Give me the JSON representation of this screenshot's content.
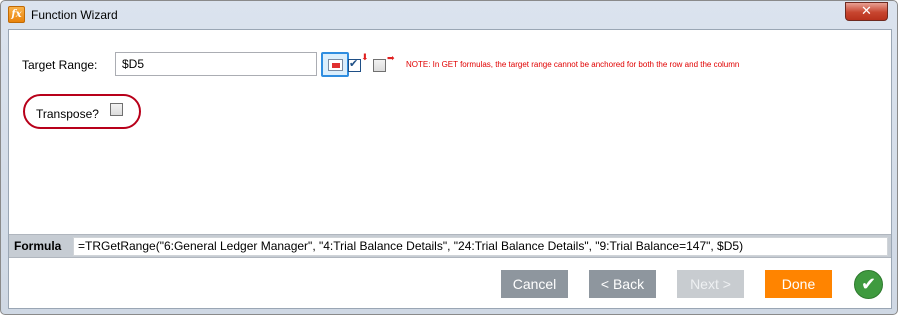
{
  "window": {
    "title": "Function Wizard",
    "icon_text": "fx",
    "close_symbol": "✕"
  },
  "target_range": {
    "label": "Target Range:",
    "value": "$D5",
    "row_anchor_checked": true,
    "column_anchor_checked": false,
    "note": "NOTE: In GET formulas, the target range cannot be anchored for both the row and the column"
  },
  "transpose": {
    "label": "Transpose?",
    "checked": false
  },
  "formula": {
    "label": "Formula",
    "value": "=TRGetRange(\"6:General Ledger Manager\", \"4:Trial Balance Details\", \"24:Trial Balance Details\", \"9:Trial Balance=147\", $D5)"
  },
  "buttons": {
    "cancel": "Cancel",
    "back": "< Back",
    "next": "Next >",
    "done": "Done"
  },
  "colors": {
    "done": "#ff8400",
    "note": "#e00000",
    "highlight_oval": "#b8001a",
    "ok": "#3f9a3f"
  }
}
